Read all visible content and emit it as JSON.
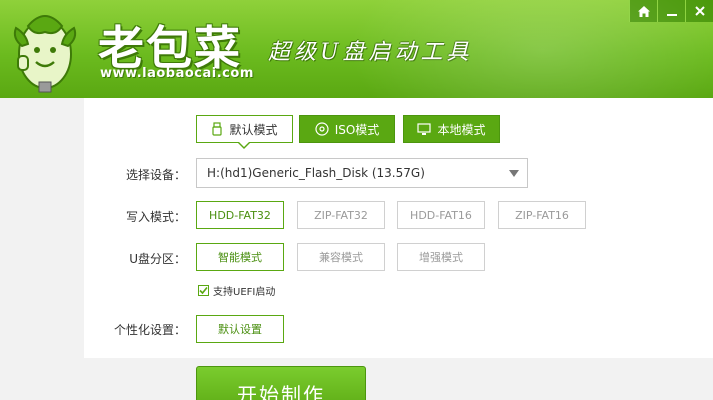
{
  "header": {
    "logo_text": "老包菜",
    "logo_url": "www.laobaocai.com",
    "slogan": "超级U盘启动工具"
  },
  "window_controls": [
    "home-icon",
    "minimize-icon",
    "close-icon"
  ],
  "mode_tabs": [
    {
      "label": "默认模式",
      "icon": "usb-icon",
      "active": true
    },
    {
      "label": "ISO模式",
      "icon": "disc-icon",
      "active": false
    },
    {
      "label": "本地模式",
      "icon": "monitor-icon",
      "active": false
    }
  ],
  "device": {
    "label": "选择设备：",
    "value": "H:(hd1)Generic_Flash_Disk (13.57G)"
  },
  "write_mode": {
    "label": "写入模式：",
    "options": [
      "HDD-FAT32",
      "ZIP-FAT32",
      "HDD-FAT16",
      "ZIP-FAT16"
    ],
    "selected": "HDD-FAT32"
  },
  "partition": {
    "label": "U盘分区：",
    "options": [
      "智能模式",
      "兼容模式",
      "增强模式"
    ],
    "selected": "智能模式"
  },
  "uefi": {
    "label": "支持UEFI启动",
    "checked": true
  },
  "personalize": {
    "label": "个性化设置：",
    "button": "默认设置"
  },
  "start_button": "开始制作",
  "colors": {
    "brand_green": "#5aa812",
    "header_green": "#7cc52b"
  }
}
